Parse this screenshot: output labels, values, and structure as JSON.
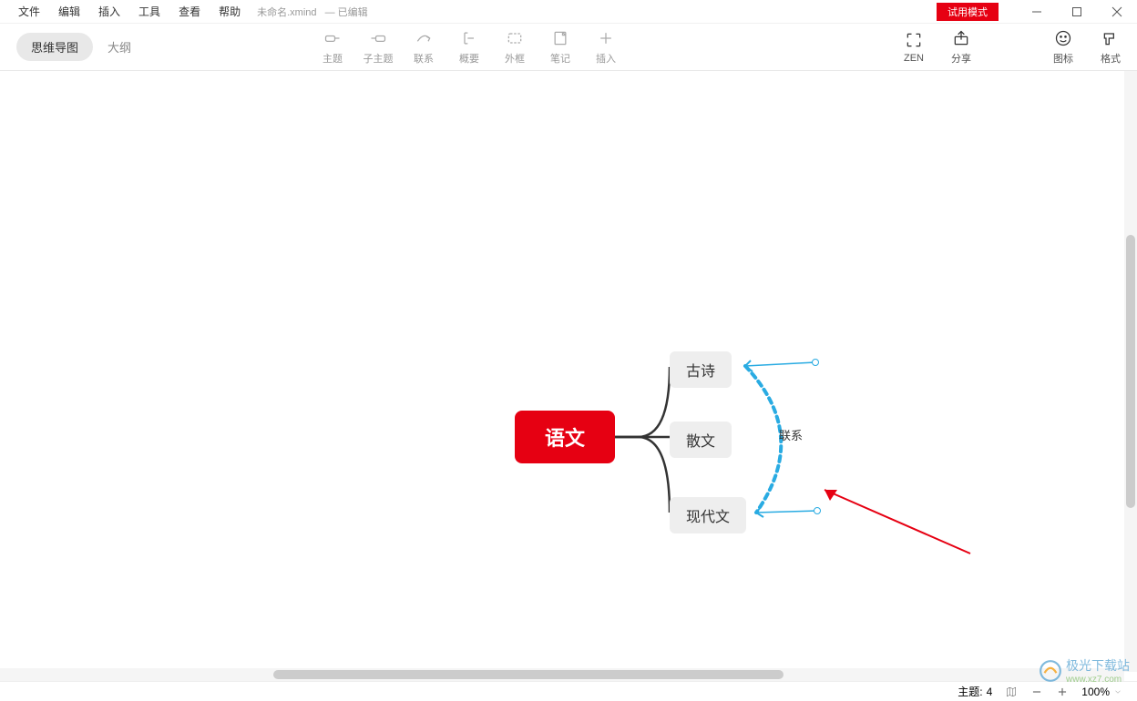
{
  "menu": {
    "file": "文件",
    "edit": "编辑",
    "insert": "插入",
    "tool": "工具",
    "view": "查看",
    "help": "帮助"
  },
  "doc": {
    "filename": "未命名.xmind",
    "status": "— 已编辑"
  },
  "window": {
    "trial": "试用模式"
  },
  "viewTabs": {
    "mind": "思维导图",
    "outline": "大纲"
  },
  "toolbar": {
    "topic": "主题",
    "subtopic": "子主题",
    "relationship": "联系",
    "summary": "概要",
    "boundary": "外框",
    "note": "笔记",
    "insert": "插入",
    "zen": "ZEN",
    "share": "分享",
    "iconPanel": "图标",
    "format": "格式"
  },
  "map": {
    "central": "语文",
    "children": {
      "a": "古诗",
      "b": "散文",
      "c": "现代文"
    },
    "relationshipLabel": "联系"
  },
  "status": {
    "topicLabel": "主题:",
    "topicCount": "4",
    "zoom": "100%"
  },
  "watermark": {
    "text": "极光下载站",
    "url": "www.xz7.com"
  }
}
